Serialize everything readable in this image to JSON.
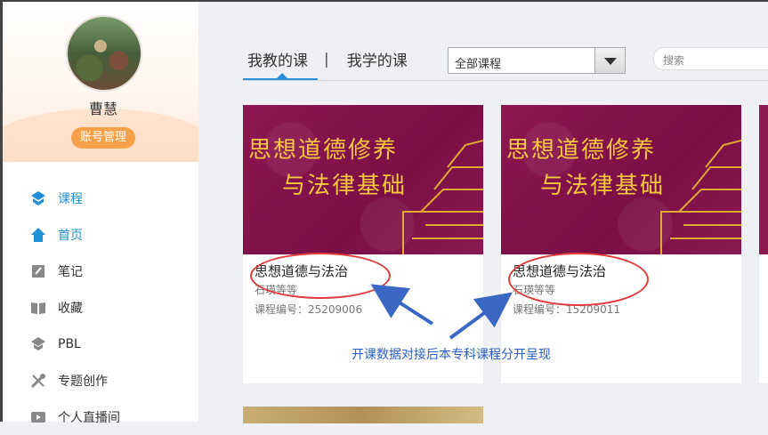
{
  "profile": {
    "name": "曹慧",
    "account_button": "账号管理"
  },
  "nav": {
    "items": [
      {
        "label": "课程",
        "icon": "course-icon",
        "active": true
      },
      {
        "label": "首页",
        "icon": "home-icon"
      },
      {
        "label": "笔记",
        "icon": "note-icon"
      },
      {
        "label": "收藏",
        "icon": "book-icon"
      },
      {
        "label": "PBL",
        "icon": "pbl-icon"
      },
      {
        "label": "专题创作",
        "icon": "tools-icon"
      },
      {
        "label": "个人直播间",
        "icon": "live-icon"
      }
    ]
  },
  "tabs": {
    "teaching": "我教的课",
    "separator": "|",
    "learning": "我学的课"
  },
  "filter": {
    "selected": "全部课程"
  },
  "search": {
    "placeholder": "搜索"
  },
  "cards": [
    {
      "banner_line1": "思想道德修养",
      "banner_line2": "与法律基础",
      "title": "思想道德与法治",
      "teacher": "石瑛等等",
      "code": "课程编号：25209006"
    },
    {
      "banner_line1": "思想道德修养",
      "banner_line2": "与法律基础",
      "title": "思想道德与法治",
      "teacher": "石瑛等等",
      "code": "课程编号：15209011"
    }
  ],
  "annotation": "开课数据对接后本专科课程分开呈现",
  "colors": {
    "accent": "#2b8fd8",
    "orange": "#f6a14a",
    "annotation_red": "#e23b3b",
    "annotation_blue": "#2b5fc0"
  }
}
